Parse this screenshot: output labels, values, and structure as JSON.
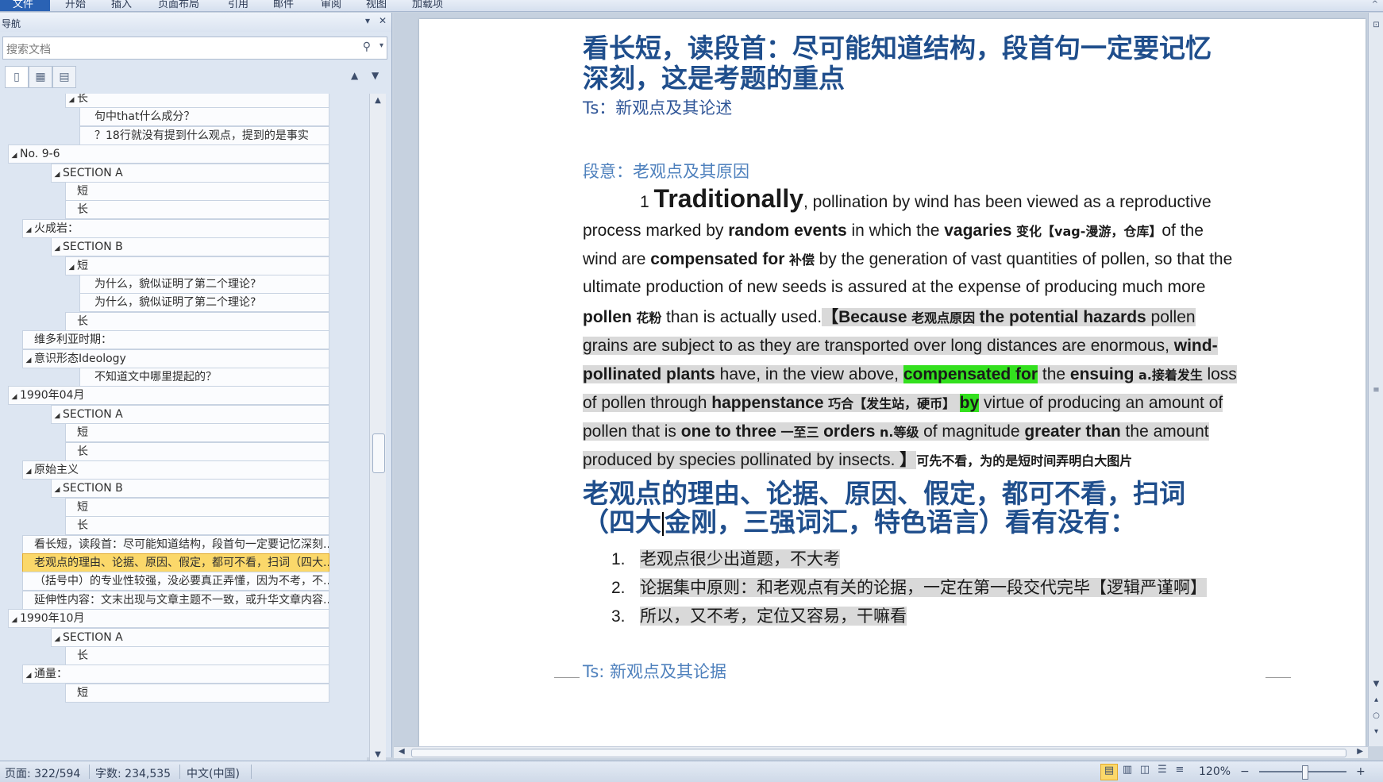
{
  "ribbon": {
    "file_tab": "文件",
    "tabs": [
      "开始",
      "插入",
      "页面布局",
      "引用",
      "邮件",
      "审阅",
      "视图",
      "加载项"
    ],
    "minimize": "^"
  },
  "nav": {
    "title": "导航",
    "dropdown": "▾",
    "close": "✕",
    "search_placeholder": "搜索文档",
    "search_icon": "⚲",
    "search_dropdown": "▾",
    "view_icons": [
      "▯",
      "▦",
      "▤"
    ],
    "up_arrow": "▲",
    "down_arrow": "▼",
    "tree": [
      {
        "label": "长",
        "level": 4,
        "expander": "◢"
      },
      {
        "label": "句中that什么成分？",
        "level": 5,
        "expander": ""
      },
      {
        "label": "？18行就没有提到什么观点，提到的是事实",
        "level": 5,
        "expander": ""
      },
      {
        "label": "No. 9-6",
        "level": 1,
        "expander": "◢"
      },
      {
        "label": "SECTION A",
        "level": 3,
        "expander": "◢"
      },
      {
        "label": "短",
        "level": 4,
        "expander": ""
      },
      {
        "label": "长",
        "level": 4,
        "expander": ""
      },
      {
        "label": "火成岩：",
        "level": 2,
        "expander": "◢"
      },
      {
        "label": "SECTION B",
        "level": 3,
        "expander": "◢"
      },
      {
        "label": "短",
        "level": 4,
        "expander": "◢"
      },
      {
        "label": "为什么，貌似证明了第二个理论?",
        "level": 5,
        "expander": ""
      },
      {
        "label": "为什么，貌似证明了第二个理论?",
        "level": 5,
        "expander": ""
      },
      {
        "label": "长",
        "level": 4,
        "expander": ""
      },
      {
        "label": "维多利亚时期：",
        "level": 2,
        "expander": ""
      },
      {
        "label": "意识形态Ideology",
        "level": 2,
        "expander": "◢"
      },
      {
        "label": "不知道文中哪里提起的？",
        "level": 5,
        "expander": ""
      },
      {
        "label": "1990年04月",
        "level": 1,
        "expander": "◢"
      },
      {
        "label": "SECTION A",
        "level": 3,
        "expander": "◢"
      },
      {
        "label": "短",
        "level": 4,
        "expander": ""
      },
      {
        "label": "长",
        "level": 4,
        "expander": ""
      },
      {
        "label": "原始主义",
        "level": 2,
        "expander": "◢"
      },
      {
        "label": "SECTION B",
        "level": 3,
        "expander": "◢"
      },
      {
        "label": "短",
        "level": 4,
        "expander": ""
      },
      {
        "label": "长",
        "level": 4,
        "expander": ""
      },
      {
        "label": "看长短，读段首：尽可能知道结构，段首句一定要记忆深刻...",
        "level": 2,
        "expander": ""
      },
      {
        "label": "老观点的理由、论据、原因、假定，都可不看，扫词（四大...",
        "level": 2,
        "expander": "",
        "selected": true
      },
      {
        "label": "（括号中）的专业性较强，没必要真正弄懂，因为不考，不...",
        "level": 2,
        "expander": ""
      },
      {
        "label": "延伸性内容：文末出现与文章主题不一致，或升华文章内容...",
        "level": 2,
        "expander": ""
      },
      {
        "label": "1990年10月",
        "level": 1,
        "expander": "◢"
      },
      {
        "label": "SECTION A",
        "level": 3,
        "expander": "◢"
      },
      {
        "label": "长",
        "level": 4,
        "expander": ""
      },
      {
        "label": "通量：",
        "level": 2,
        "expander": "◢"
      },
      {
        "label": "短",
        "level": 4,
        "expander": ""
      }
    ]
  },
  "doc": {
    "heading1_line1": "看长短，读段首：尽可能知道结构，段首句一定要记忆",
    "heading1_line2": "深刻，这是考题的重点",
    "ts1": "Ts：新观点及其论述",
    "para_meaning": "段意：老观点及其原因",
    "p1": {
      "num": "1",
      "traditionally": "Traditionally",
      "l1_rest": ", pollination by wind has been viewed as a reproductive",
      "l2_a": "process marked by ",
      "l2_b": "random events",
      "l2_c": " in which the ",
      "l2_d": "vagaries",
      "l2_e": " 变化【vag-漫游，仓库】",
      "l2_f": "of the",
      "l3_a": "wind are ",
      "l3_b": "compensated for",
      "l3_c": " 补偿 ",
      "l3_d": "by the generation of vast quantities of pollen, so that the",
      "l4": "ultimate production of new seeds is assured at the expense of producing much more",
      "l5_a": "pollen",
      "l5_b": " 花粉 ",
      "l5_c": "than is actually used.",
      "l5_d": "【",
      "l5_e": "Because",
      "l5_f": " 老观点原因 ",
      "l5_g": "the potential hazards",
      "l5_h": " pollen",
      "l6_a": "grains are subject to as they are transported over long distances are enormous, ",
      "l6_b": "wind-",
      "l7_a": "pollinated plants",
      "l7_b": " have, in the view above, ",
      "l7_c": "compensated for",
      "l7_d": " the ",
      "l7_e": "ensuing",
      "l7_f": " a.接着发生 ",
      "l7_g": "loss",
      "l8_a": "of pollen through ",
      "l8_b": "happenstance",
      "l8_c": " 巧合【发生站，硬币】 ",
      "l8_d": "by",
      "l8_e": " virtue of producing an amount of",
      "l9_a": "pollen that is ",
      "l9_b": "one to three",
      "l9_c": " 一至三 ",
      "l9_d": "orders",
      "l9_e": " n.等级 ",
      "l9_f": "of magnitude ",
      "l9_g": "greater than",
      "l9_h": " the amount",
      "l10_a": "produced by species pollinated by insects.",
      "l10_b": " 】",
      "l10_c": "可先不看，为的是短时间弄明白大图片"
    },
    "heading2_line1": "老观点的理由、论据、原因、假定，都可不看，扫词",
    "heading2_line2a": "（四大",
    "heading2_line2b": "金刚，三强词汇，特色语言）看有没有：",
    "list": [
      {
        "num": "1.",
        "text": "老观点很少出道题，不大考"
      },
      {
        "num": "2.",
        "text": "论据集中原则：和老观点有关的论据，一定在第一段交代完毕【逻辑严谨啊】"
      },
      {
        "num": "3.",
        "text": "所以，又不考，定位又容易，干嘛看"
      }
    ],
    "ts2": "Ts: 新观点及其论据"
  },
  "status": {
    "page": "页面: 322/594",
    "words": "字数: 234,535",
    "lang": "中文(中国)",
    "zoom": "120%",
    "zoom_minus": "−",
    "zoom_plus": "+"
  }
}
